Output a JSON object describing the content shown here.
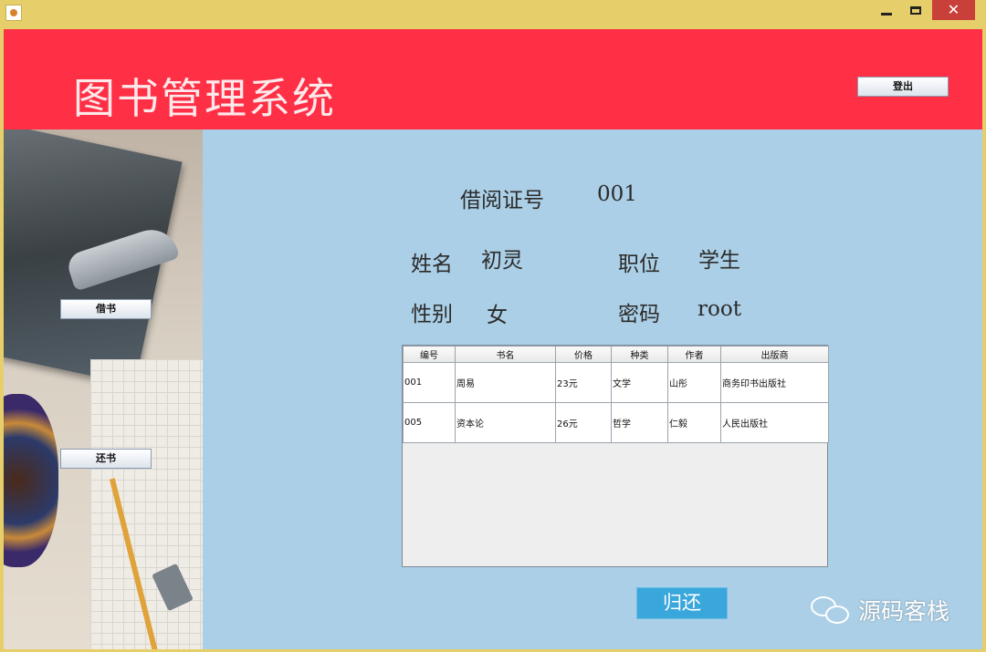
{
  "header": {
    "title": "图书管理系统",
    "logout_label": "登出"
  },
  "sidebar": {
    "borrow_label": "借书",
    "return_label": "还书"
  },
  "reader": {
    "card_label": "借阅证号",
    "card_value": "001",
    "name_label": "姓名",
    "name_value": "初灵",
    "position_label": "职位",
    "position_value": "学生",
    "gender_label": "性别",
    "gender_value": "女",
    "password_label": "密码",
    "password_value": "root"
  },
  "table": {
    "headers": [
      "编号",
      "书名",
      "价格",
      "种类",
      "作者",
      "出版商"
    ],
    "rows": [
      [
        "001",
        "周易",
        "23元",
        "文学",
        "山彤",
        "商务印书出版社"
      ],
      [
        "005",
        "资本论",
        "26元",
        "哲学",
        "仁毅",
        "人民出版社"
      ]
    ]
  },
  "actions": {
    "return_label": "归还"
  },
  "watermark": {
    "text": "源码客栈"
  },
  "colors": {
    "header_bg": "#ff2f46",
    "content_bg": "#abcfe6",
    "window_frame": "#e6cf6a",
    "return_button": "#3aa7dc"
  }
}
